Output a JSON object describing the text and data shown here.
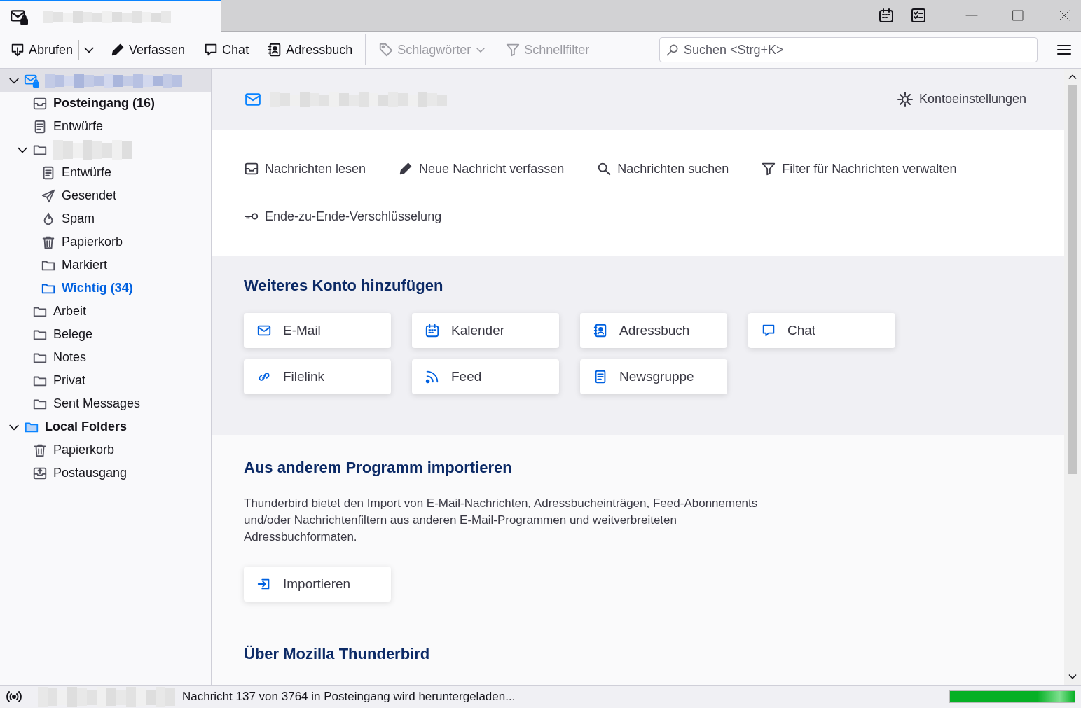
{
  "tab": {
    "selected": true
  },
  "toolbar": {
    "groups": [
      [
        {
          "kind": "get",
          "label": "Abrufen",
          "disabled": false,
          "has_menu": true
        },
        {
          "kind": "compose",
          "label": "Verfassen",
          "disabled": false,
          "has_menu": false
        },
        {
          "kind": "chat",
          "label": "Chat",
          "disabled": false,
          "has_menu": false
        },
        {
          "kind": "addressbook",
          "label": "Adressbuch",
          "disabled": false,
          "has_menu": false
        }
      ],
      [
        {
          "kind": "tags",
          "label": "Schlagwörter",
          "disabled": true,
          "has_menu": true
        },
        {
          "kind": "filter",
          "label": "Schnellfilter",
          "disabled": true,
          "has_menu": false
        }
      ]
    ],
    "search": {
      "placeholder": "Suchen <Strg+K>"
    }
  },
  "folder_tree": [
    {
      "kind": "account",
      "selected": true,
      "expanded": true,
      "children": [
        {
          "kind": "inbox",
          "label": "Posteingang (16)",
          "selected": false,
          "unread": true,
          "new_mail": false
        },
        {
          "kind": "drafts",
          "label": "Entwürfe",
          "selected": false,
          "unread": false,
          "new_mail": false
        },
        {
          "kind": "folder",
          "selected": false,
          "expanded": true,
          "children": [
            {
              "kind": "drafts",
              "label": "Entwürfe",
              "selected": false,
              "unread": false,
              "new_mail": false
            },
            {
              "kind": "sent",
              "label": "Gesendet",
              "selected": false,
              "unread": false,
              "new_mail": false
            },
            {
              "kind": "junk",
              "label": "Spam",
              "selected": false,
              "unread": false,
              "new_mail": false
            },
            {
              "kind": "trash",
              "label": "Papierkorb",
              "selected": false,
              "unread": false,
              "new_mail": false
            },
            {
              "kind": "folder",
              "label": "Markiert",
              "selected": false,
              "unread": false,
              "new_mail": false
            },
            {
              "kind": "folder",
              "label": "Wichtig (34)",
              "selected": false,
              "unread": true,
              "new_mail": true
            }
          ]
        },
        {
          "kind": "folder",
          "label": "Arbeit",
          "selected": false,
          "unread": false,
          "new_mail": false
        },
        {
          "kind": "folder",
          "label": "Belege",
          "selected": false,
          "unread": false,
          "new_mail": false
        },
        {
          "kind": "folder",
          "label": "Notes",
          "selected": false,
          "unread": false,
          "new_mail": false
        },
        {
          "kind": "folder",
          "label": "Privat",
          "selected": false,
          "unread": false,
          "new_mail": false
        },
        {
          "kind": "folder",
          "label": "Sent Messages",
          "selected": false,
          "unread": false,
          "new_mail": false
        }
      ]
    },
    {
      "kind": "local",
      "label": "Local Folders",
      "selected": false,
      "new_mail": false,
      "expanded": true,
      "children": [
        {
          "kind": "trash",
          "label": "Papierkorb",
          "selected": false,
          "unread": false,
          "new_mail": false
        },
        {
          "kind": "outbox",
          "label": "Postausgang",
          "selected": false,
          "unread": false,
          "new_mail": false
        }
      ]
    }
  ],
  "account_hub": {
    "settings_link": "Kontoeinstellungen",
    "actions": [
      {
        "kind": "read",
        "label": "Nachrichten lesen"
      },
      {
        "kind": "compose",
        "label": "Neue Nachricht verfassen"
      },
      {
        "kind": "search",
        "label": "Nachrichten suchen"
      },
      {
        "kind": "filter",
        "label": "Filter für Nachrichten verwalten"
      },
      {
        "kind": "e2e",
        "label": "Ende-zu-Ende-Verschlüsselung"
      }
    ],
    "add_account": {
      "title": "Weiteres Konto hinzufügen",
      "options": [
        {
          "kind": "mail",
          "label": "E-Mail"
        },
        {
          "kind": "calendar",
          "label": "Kalender"
        },
        {
          "kind": "addressbook",
          "label": "Adressbuch"
        },
        {
          "kind": "chat",
          "label": "Chat"
        },
        {
          "kind": "filelink",
          "label": "Filelink"
        },
        {
          "kind": "feed",
          "label": "Feed"
        },
        {
          "kind": "news",
          "label": "Newsgruppe"
        }
      ]
    },
    "import": {
      "title": "Aus anderem Programm importieren",
      "text": "Thunderbird bietet den Import von E-Mail-Nachrichten, Adressbucheinträgen, Feed-Abonnements und/oder Nachrichtenfiltern aus anderen E-Mail-Programmen und weitverbreiteten Adressbuchformaten.",
      "button": "Importieren"
    },
    "about": {
      "title": "Über Mozilla Thunderbird"
    }
  },
  "status_bar": {
    "message": "Nachricht 137 von 3764 in Posteingang wird heruntergeladen...",
    "progress": {
      "level": 1
    }
  }
}
